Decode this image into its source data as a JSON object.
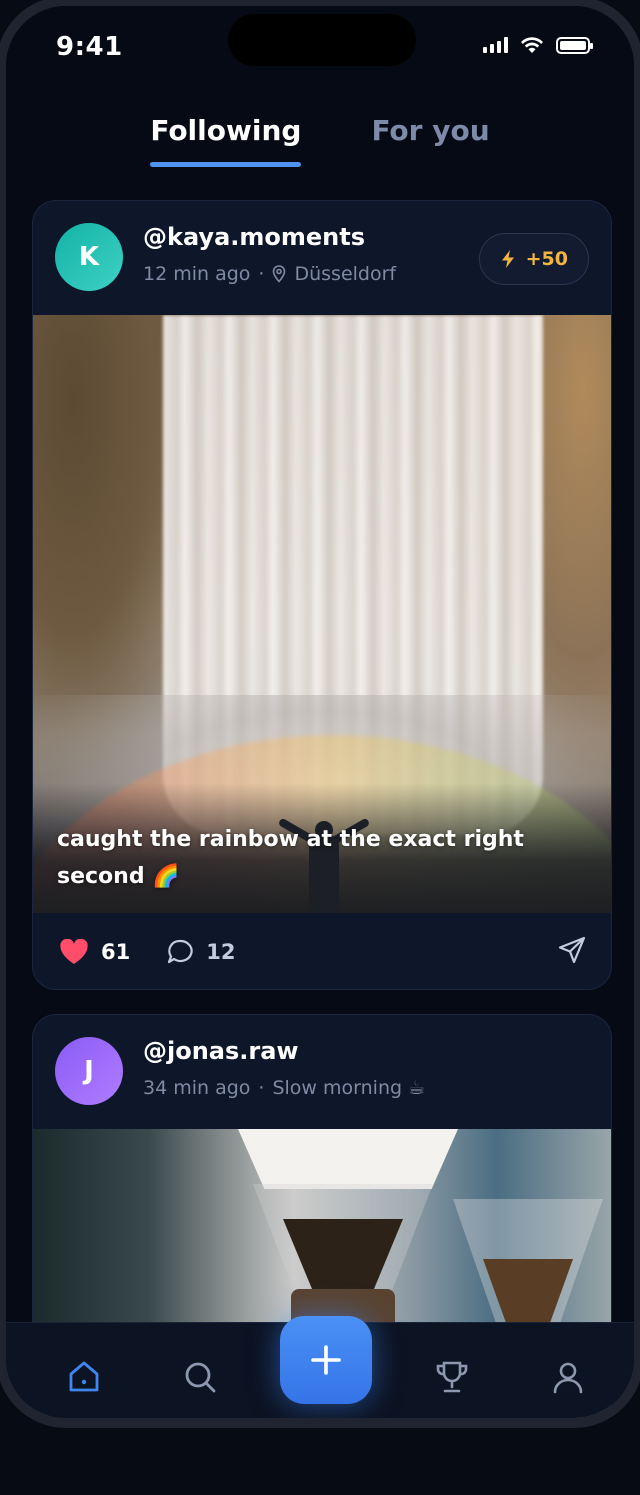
{
  "status_bar": {
    "time": "9:41"
  },
  "tabs": [
    {
      "label": "Following",
      "active": true
    },
    {
      "label": "For you",
      "active": false
    }
  ],
  "posts": [
    {
      "avatar_letter": "K",
      "avatar_color": "#1fbfb2",
      "handle": "@kaya.moments",
      "time_ago": "12 min ago",
      "separator": "·",
      "location": "Düsseldorf",
      "points": "+50",
      "caption": "caught the rainbow at the exact right second 🌈",
      "likes": "61",
      "comments": "12"
    },
    {
      "avatar_letter": "J",
      "avatar_color": "#9a6cfa",
      "handle": "@jonas.raw",
      "time_ago": "34 min ago",
      "separator": "·",
      "location": "Slow morning ☕"
    }
  ],
  "bottom_nav": {
    "items": [
      "home-icon",
      "search-icon",
      "add-icon",
      "trophy-icon",
      "profile-icon"
    ],
    "accent": "#3f86f0"
  },
  "colors": {
    "accent": "#4e94f0",
    "points": "#f2b640",
    "like": "#ff4d6a"
  }
}
